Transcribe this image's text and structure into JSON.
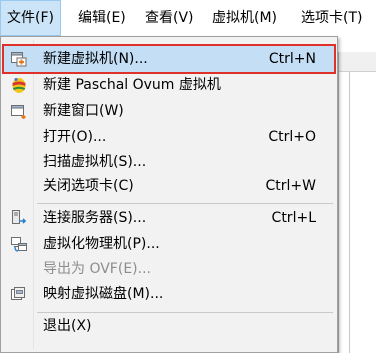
{
  "menubar": {
    "items": [
      {
        "label": "文件(F)"
      },
      {
        "label": "编辑(E)"
      },
      {
        "label": "查看(V)"
      },
      {
        "label": "虚拟机(M)"
      },
      {
        "label": "选项卡(T)"
      }
    ]
  },
  "file_menu": {
    "items": [
      {
        "label": "新建虚拟机(N)...",
        "shortcut": "Ctrl+N",
        "icon": "new-vm-icon"
      },
      {
        "label": "新建 Paschal Ovum 虚拟机",
        "shortcut": "",
        "icon": "paschal-ovum-icon"
      },
      {
        "label": "新建窗口(W)",
        "shortcut": "",
        "icon": "new-window-icon"
      },
      {
        "label": "打开(O)...",
        "shortcut": "Ctrl+O"
      },
      {
        "label": "扫描虚拟机(S)...",
        "shortcut": ""
      },
      {
        "label": "关闭选项卡(C)",
        "shortcut": "Ctrl+W"
      },
      {
        "label": "连接服务器(S)...",
        "shortcut": "Ctrl+L",
        "icon": "connect-server-icon"
      },
      {
        "label": "虚拟化物理机(P)...",
        "shortcut": "",
        "icon": "virtualize-physical-icon"
      },
      {
        "label": "导出为 OVF(E)...",
        "shortcut": "",
        "disabled": true
      },
      {
        "label": "映射虚拟磁盘(M)...",
        "shortcut": "",
        "icon": "map-disk-icon"
      },
      {
        "label": "退出(X)",
        "shortcut": ""
      }
    ]
  },
  "colors": {
    "highlight": "#c3def5",
    "highlight_border": "#e0302a",
    "menu_bg": "#f2f2f2",
    "disabled_text": "#8d8d8d"
  }
}
